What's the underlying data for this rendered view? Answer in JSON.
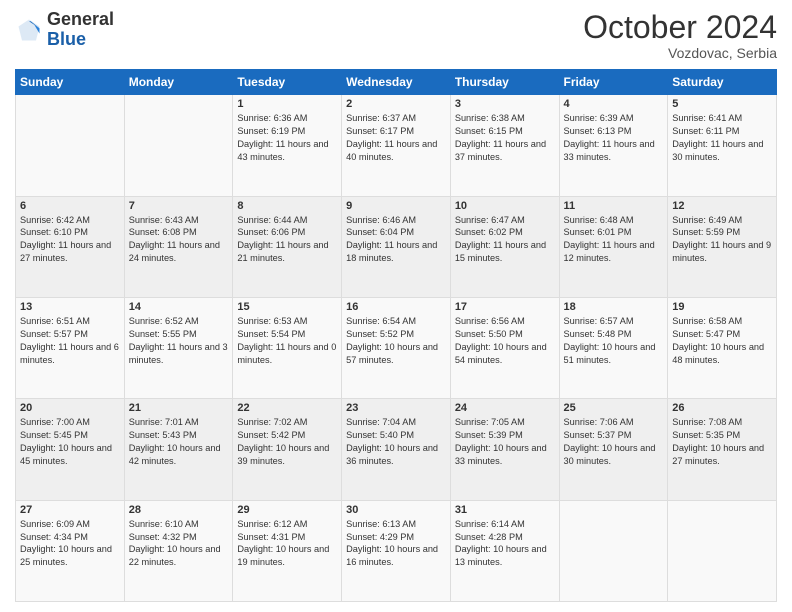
{
  "header": {
    "logo_general": "General",
    "logo_blue": "Blue",
    "month_title": "October 2024",
    "location": "Vozdovac, Serbia"
  },
  "days_of_week": [
    "Sunday",
    "Monday",
    "Tuesday",
    "Wednesday",
    "Thursday",
    "Friday",
    "Saturday"
  ],
  "weeks": [
    [
      {
        "day": "",
        "info": ""
      },
      {
        "day": "",
        "info": ""
      },
      {
        "day": "1",
        "info": "Sunrise: 6:36 AM\nSunset: 6:19 PM\nDaylight: 11 hours and 43 minutes."
      },
      {
        "day": "2",
        "info": "Sunrise: 6:37 AM\nSunset: 6:17 PM\nDaylight: 11 hours and 40 minutes."
      },
      {
        "day": "3",
        "info": "Sunrise: 6:38 AM\nSunset: 6:15 PM\nDaylight: 11 hours and 37 minutes."
      },
      {
        "day": "4",
        "info": "Sunrise: 6:39 AM\nSunset: 6:13 PM\nDaylight: 11 hours and 33 minutes."
      },
      {
        "day": "5",
        "info": "Sunrise: 6:41 AM\nSunset: 6:11 PM\nDaylight: 11 hours and 30 minutes."
      }
    ],
    [
      {
        "day": "6",
        "info": "Sunrise: 6:42 AM\nSunset: 6:10 PM\nDaylight: 11 hours and 27 minutes."
      },
      {
        "day": "7",
        "info": "Sunrise: 6:43 AM\nSunset: 6:08 PM\nDaylight: 11 hours and 24 minutes."
      },
      {
        "day": "8",
        "info": "Sunrise: 6:44 AM\nSunset: 6:06 PM\nDaylight: 11 hours and 21 minutes."
      },
      {
        "day": "9",
        "info": "Sunrise: 6:46 AM\nSunset: 6:04 PM\nDaylight: 11 hours and 18 minutes."
      },
      {
        "day": "10",
        "info": "Sunrise: 6:47 AM\nSunset: 6:02 PM\nDaylight: 11 hours and 15 minutes."
      },
      {
        "day": "11",
        "info": "Sunrise: 6:48 AM\nSunset: 6:01 PM\nDaylight: 11 hours and 12 minutes."
      },
      {
        "day": "12",
        "info": "Sunrise: 6:49 AM\nSunset: 5:59 PM\nDaylight: 11 hours and 9 minutes."
      }
    ],
    [
      {
        "day": "13",
        "info": "Sunrise: 6:51 AM\nSunset: 5:57 PM\nDaylight: 11 hours and 6 minutes."
      },
      {
        "day": "14",
        "info": "Sunrise: 6:52 AM\nSunset: 5:55 PM\nDaylight: 11 hours and 3 minutes."
      },
      {
        "day": "15",
        "info": "Sunrise: 6:53 AM\nSunset: 5:54 PM\nDaylight: 11 hours and 0 minutes."
      },
      {
        "day": "16",
        "info": "Sunrise: 6:54 AM\nSunset: 5:52 PM\nDaylight: 10 hours and 57 minutes."
      },
      {
        "day": "17",
        "info": "Sunrise: 6:56 AM\nSunset: 5:50 PM\nDaylight: 10 hours and 54 minutes."
      },
      {
        "day": "18",
        "info": "Sunrise: 6:57 AM\nSunset: 5:48 PM\nDaylight: 10 hours and 51 minutes."
      },
      {
        "day": "19",
        "info": "Sunrise: 6:58 AM\nSunset: 5:47 PM\nDaylight: 10 hours and 48 minutes."
      }
    ],
    [
      {
        "day": "20",
        "info": "Sunrise: 7:00 AM\nSunset: 5:45 PM\nDaylight: 10 hours and 45 minutes."
      },
      {
        "day": "21",
        "info": "Sunrise: 7:01 AM\nSunset: 5:43 PM\nDaylight: 10 hours and 42 minutes."
      },
      {
        "day": "22",
        "info": "Sunrise: 7:02 AM\nSunset: 5:42 PM\nDaylight: 10 hours and 39 minutes."
      },
      {
        "day": "23",
        "info": "Sunrise: 7:04 AM\nSunset: 5:40 PM\nDaylight: 10 hours and 36 minutes."
      },
      {
        "day": "24",
        "info": "Sunrise: 7:05 AM\nSunset: 5:39 PM\nDaylight: 10 hours and 33 minutes."
      },
      {
        "day": "25",
        "info": "Sunrise: 7:06 AM\nSunset: 5:37 PM\nDaylight: 10 hours and 30 minutes."
      },
      {
        "day": "26",
        "info": "Sunrise: 7:08 AM\nSunset: 5:35 PM\nDaylight: 10 hours and 27 minutes."
      }
    ],
    [
      {
        "day": "27",
        "info": "Sunrise: 6:09 AM\nSunset: 4:34 PM\nDaylight: 10 hours and 25 minutes."
      },
      {
        "day": "28",
        "info": "Sunrise: 6:10 AM\nSunset: 4:32 PM\nDaylight: 10 hours and 22 minutes."
      },
      {
        "day": "29",
        "info": "Sunrise: 6:12 AM\nSunset: 4:31 PM\nDaylight: 10 hours and 19 minutes."
      },
      {
        "day": "30",
        "info": "Sunrise: 6:13 AM\nSunset: 4:29 PM\nDaylight: 10 hours and 16 minutes."
      },
      {
        "day": "31",
        "info": "Sunrise: 6:14 AM\nSunset: 4:28 PM\nDaylight: 10 hours and 13 minutes."
      },
      {
        "day": "",
        "info": ""
      },
      {
        "day": "",
        "info": ""
      }
    ]
  ]
}
